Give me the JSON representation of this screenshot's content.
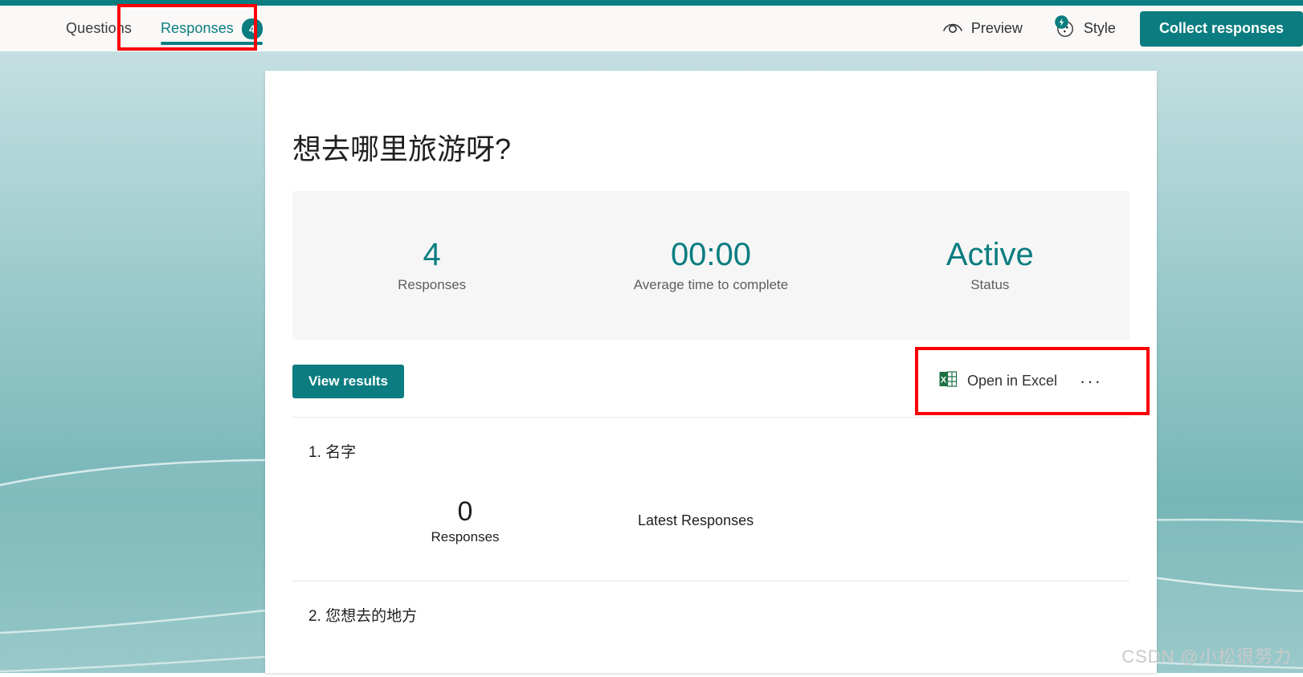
{
  "app": {
    "accent_color": "#0b7d80",
    "annotation_color": "#fb0007"
  },
  "command_bar": {
    "tabs": [
      {
        "label": "Questions",
        "badge": "",
        "active": false
      },
      {
        "label": "Responses",
        "badge": "4",
        "active": true
      }
    ],
    "actions": [
      {
        "label": "Preview",
        "icon": "eye-icon"
      },
      {
        "label": "Style",
        "icon": "style-palette-icon"
      }
    ],
    "collect_button": "Collect responses"
  },
  "form": {
    "title": "想去哪里旅游呀?",
    "summary": [
      {
        "value": "4",
        "label": "Responses"
      },
      {
        "value": "00:00",
        "label": "Average time to complete"
      },
      {
        "value": "Active",
        "label": "Status"
      }
    ],
    "view_results_button": "View results",
    "open_in_excel": "Open in Excel",
    "more_options": "···",
    "questions": [
      {
        "number": "1.",
        "title": "名字",
        "count_value": "0",
        "count_label": "Responses",
        "latest_label": "Latest Responses"
      },
      {
        "number": "2.",
        "title": "您想去的地方",
        "count_value": "",
        "count_label": "",
        "latest_label": ""
      }
    ]
  },
  "watermark": "CSDN @小松很努力"
}
